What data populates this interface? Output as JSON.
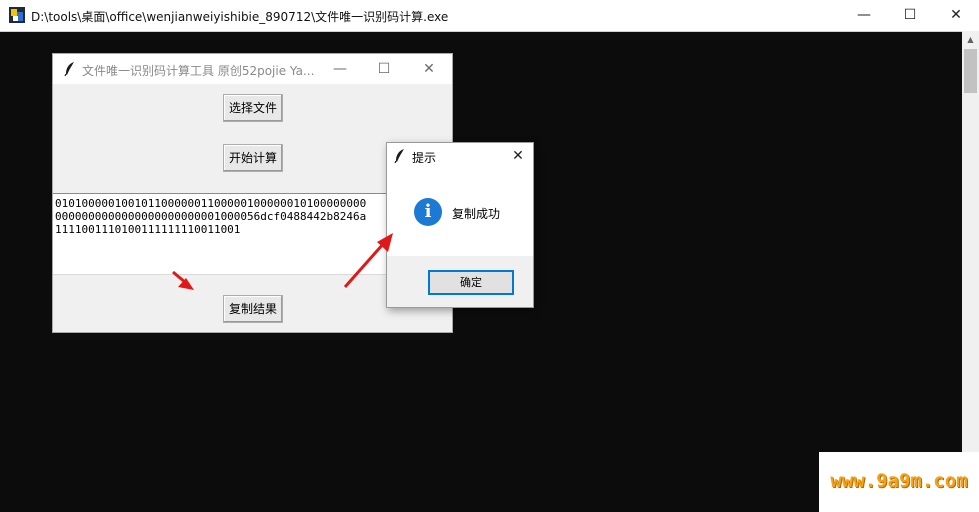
{
  "console": {
    "title": "D:\\tools\\桌面\\office\\wenjianweiyishibie_890712\\文件唯一识别码计算.exe",
    "minimize": "—",
    "maximize": "☐",
    "close": "✕"
  },
  "tool": {
    "title": "文件唯一识别码计算工具 原创52pojie Ya...",
    "minimize": "—",
    "maximize": "☐",
    "close": "✕",
    "select_file_label": "选择文件",
    "start_calc_label": "开始计算",
    "copy_result_label": "复制结果",
    "output_lines": [
      "01010000010010110000001100000100000010100000000",
      "0000000000000000000000001000056dcf0488442b8246a",
      "1111001110100111111110011001"
    ]
  },
  "dialog": {
    "title": "提示",
    "close": "✕",
    "message": "复制成功",
    "ok_label": "确定",
    "icon": "info-icon"
  },
  "watermark": {
    "text": "www.9a9m.com"
  },
  "colors": {
    "console_bg": "#0c0c0c",
    "arrow": "#e01818",
    "info_blue": "#1c79d4",
    "focus_blue": "#0078d7",
    "watermark_orange": "#f3a21c"
  }
}
